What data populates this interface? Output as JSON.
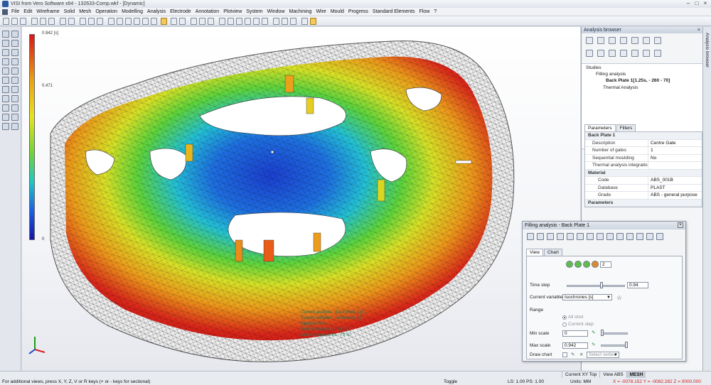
{
  "window": {
    "title": "VISI from Vero Software x64 - 132633-Comp.wkf - [Dynamic]",
    "controls": [
      "–",
      "□",
      "×"
    ]
  },
  "menu": [
    "File",
    "Edit",
    "Wireframe",
    "Solid",
    "Mesh",
    "Operation",
    "Modelling",
    "Analysis",
    "Electrode",
    "Annotation",
    "Plotview",
    "System",
    "Window",
    "Machining",
    "Wire",
    "Mould",
    "Progress",
    "Standard Elements",
    "Flow",
    "?"
  ],
  "viewport": {
    "colorbar": {
      "top_label": "0.942 [s]",
      "mid_label": "0.471",
      "bottom_label": "0"
    },
    "info_lines": [
      "Current analysis : Back Plate 1 [1...",
      "Current variable : Isochrones [s]",
      "Injection time : ...",
      "Melt temperature : 260 °C",
      "Mould temperature : 70 °C"
    ]
  },
  "analysis_browser": {
    "title": "Analysis browser",
    "close": "×",
    "side_tab": "Analysis browser",
    "tree": {
      "studies": "Studies",
      "filling": "Filling analysis",
      "item": "Back Plate 1[1.25s, - 260 - 70]",
      "thermal": "Thermal Analysis"
    },
    "tabs": [
      "Parameters",
      "Filters"
    ],
    "section": "Back Plate 1",
    "params": [
      {
        "k": "Description",
        "v": "Centre Gate"
      },
      {
        "k": "Number of gates",
        "v": "1"
      },
      {
        "k": "Sequential moulding",
        "v": "No"
      },
      {
        "k": "Thermal analysis integration",
        "v": ""
      }
    ],
    "material_section": "Material",
    "material": [
      {
        "k": "Code",
        "v": "ABS_001B"
      },
      {
        "k": "Database",
        "v": "PLAST"
      },
      {
        "k": "Grade",
        "v": "ABS - general purpose"
      }
    ],
    "parameters_section": "Parameters"
  },
  "fill_dialog": {
    "title": "Filling analysis - Back Plate 1",
    "close": "×",
    "tabs": [
      "View",
      "Chart"
    ],
    "step_value": "2",
    "time_step_label": "Time step",
    "time_step_value": "0.94",
    "current_variable_label": "Current variable",
    "current_variable_value": "Isochrones [s]",
    "range_label": "Range",
    "range_all": "All shot",
    "range_current": "Current step",
    "min_scale_label": "Min scale",
    "min_scale_value": "0",
    "max_scale_label": "Max scale",
    "max_scale_value": "0.942",
    "draw_chart_label": "Draw chart",
    "select_vertex": "Select vertex"
  },
  "statusbar": {
    "hint": "For additional views, press X, Y, Z, V or R keys (+ or - keys for sectional)",
    "toggle": "Toggle",
    "ls_ps": "LS: 1.00  PS: 1.00",
    "units": "Units: MM",
    "coords": "X = -0078.152  Y = -0082.282  Z = 0000.000",
    "view_current": "Current XY Top",
    "view_abs": "View ABS",
    "mesh": "MESH"
  }
}
